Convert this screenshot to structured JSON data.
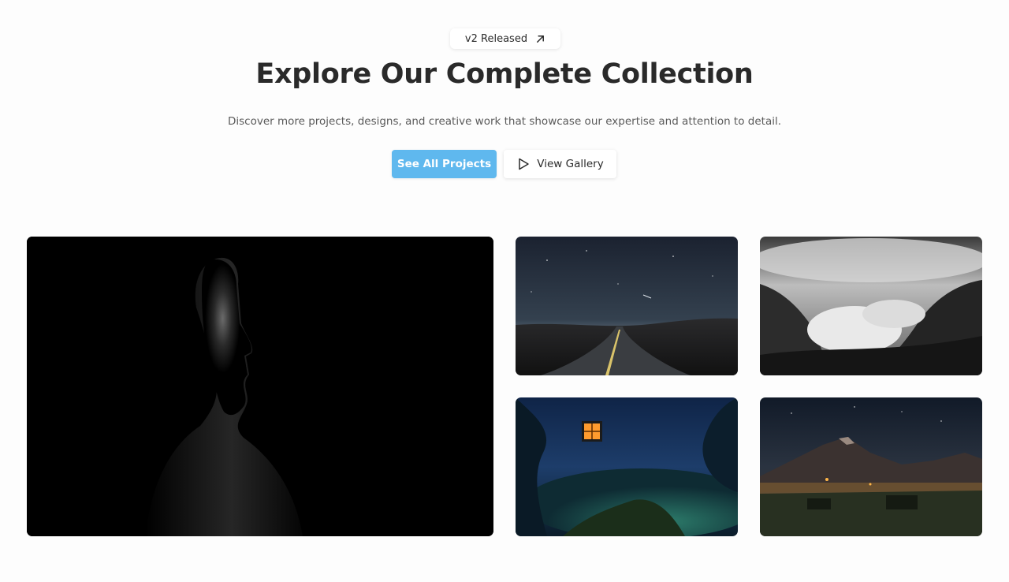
{
  "badge": {
    "label": "v2 Released",
    "icon": "arrow-up-right-icon"
  },
  "hero": {
    "title": "Explore Our Complete Collection",
    "subtitle": "Discover more projects, designs, and creative work that showcase our expertise and attention to detail."
  },
  "actions": {
    "primary_label": "See All Projects",
    "secondary_label": "View Gallery",
    "secondary_icon": "play-icon"
  },
  "gallery": {
    "images": [
      {
        "subject": "portrait-silhouette"
      },
      {
        "subject": "night-road"
      },
      {
        "subject": "cloudy-mountains"
      },
      {
        "subject": "forest-lantern"
      },
      {
        "subject": "mountain-night-village"
      }
    ]
  },
  "colors": {
    "accent": "#5fb8ee",
    "background": "#fdfdfd",
    "title": "#2a2a2a",
    "subtitle": "#5b5b5b"
  }
}
